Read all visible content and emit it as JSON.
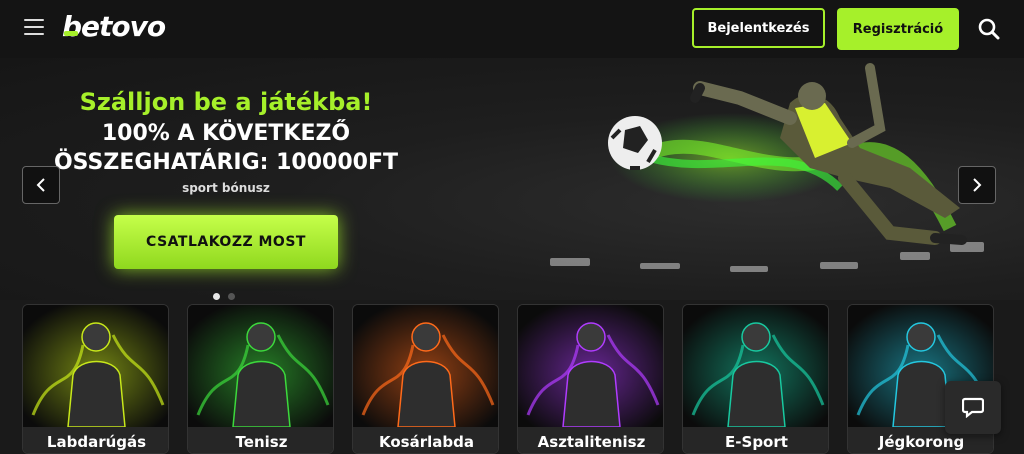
{
  "header": {
    "logo_text": "betovo",
    "login_label": "Bejelentkezés",
    "register_label": "Regisztráció",
    "icons": {
      "menu": "hamburger-menu-icon",
      "search": "search-icon"
    }
  },
  "hero": {
    "headline": "Szálljon be a játékba!",
    "offer_line1": "100% A KÖVETKEZŐ",
    "offer_line2": "ÖSSZEGHATÁRIG: 100000FT",
    "subtitle": "sport bónusz",
    "cta_label": "CSATLAKOZZ MOST",
    "slide_count": 2,
    "active_slide": 1,
    "icons": {
      "prev": "chevron-left-icon",
      "next": "chevron-right-icon"
    }
  },
  "categories": [
    {
      "label": "Labdarúgás",
      "glow": "#c8e81a"
    },
    {
      "label": "Tenisz",
      "glow": "#3cd93c"
    },
    {
      "label": "Kosárlabda",
      "glow": "#ff6a1a"
    },
    {
      "label": "Asztalitenisz",
      "glow": "#b03cff"
    },
    {
      "label": "E-Sport",
      "glow": "#18c9a0"
    },
    {
      "label": "Jégkorong",
      "glow": "#24c8e0"
    }
  ],
  "chat": {
    "icon": "chat-bubble-icon"
  },
  "colors": {
    "accent": "#a6f02a",
    "background": "#1a1a1a",
    "header": "#141414"
  }
}
